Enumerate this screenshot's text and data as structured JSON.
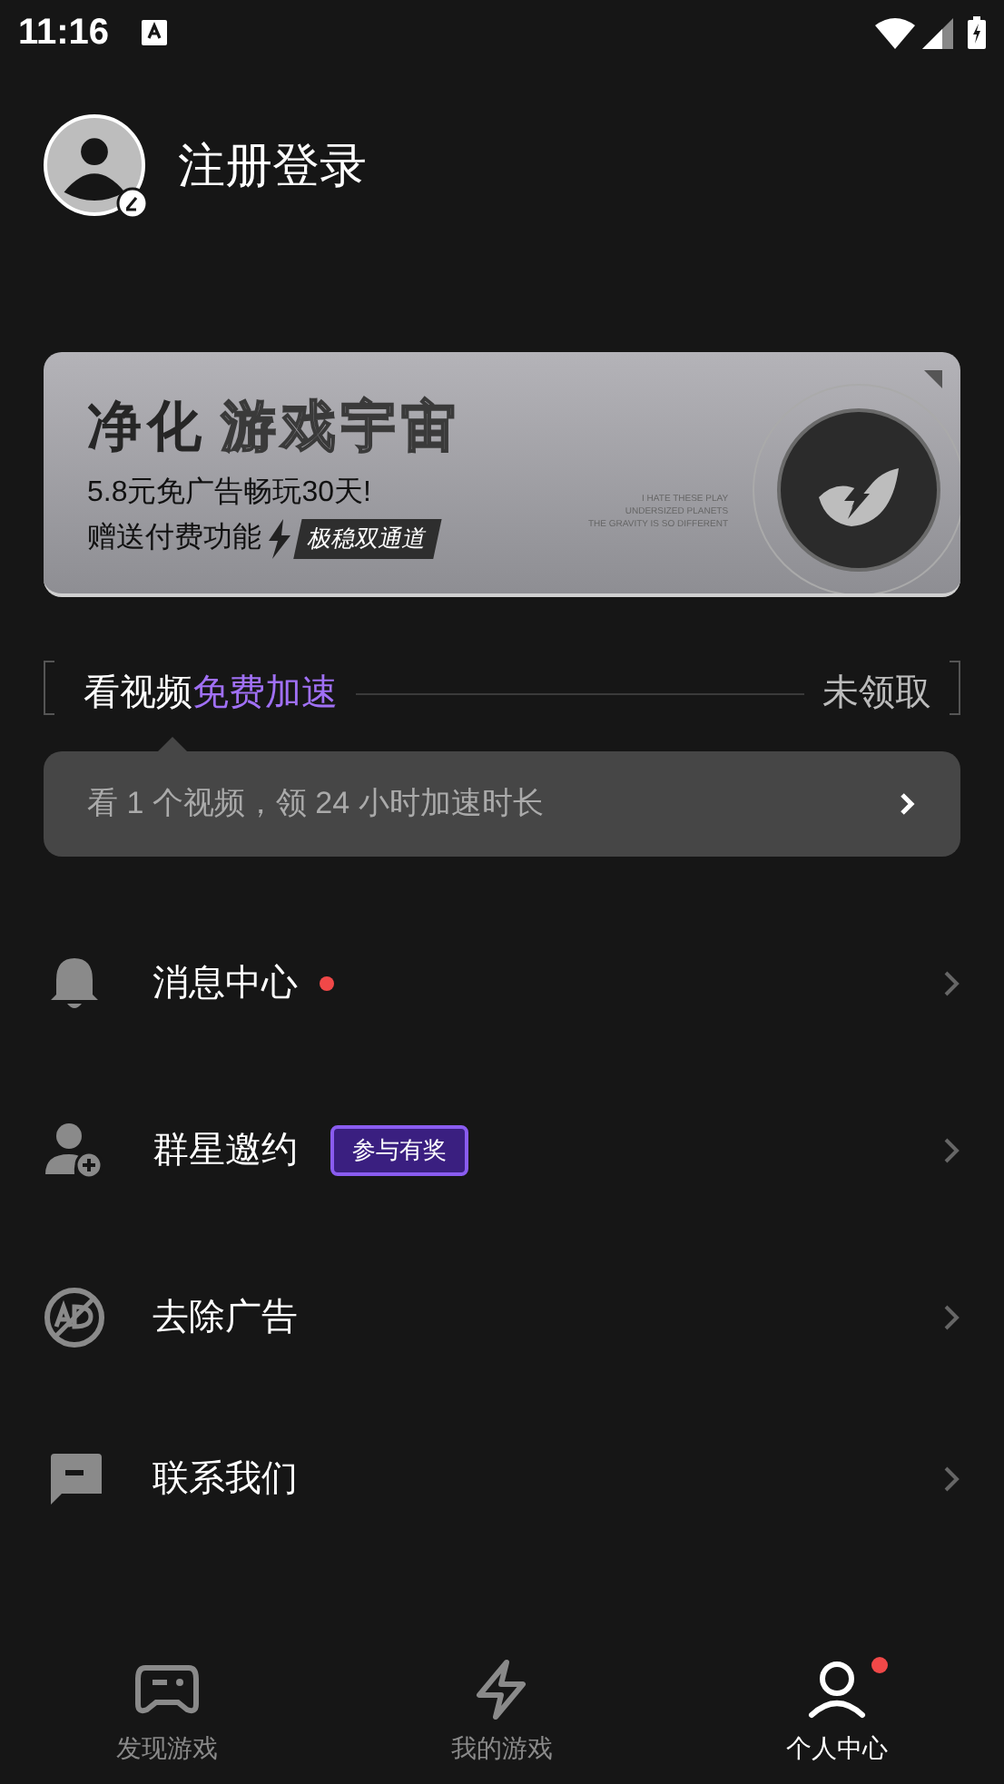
{
  "status_bar": {
    "time": "11:16"
  },
  "profile": {
    "login_label": "注册登录"
  },
  "banner": {
    "title_bold": "净化",
    "title_outline": "游戏宇宙",
    "line_1": "5.8元免广告畅玩30天!",
    "line_2": "赠送付费功能",
    "tag": "极稳双通道",
    "tagline": [
      "I HATE THESE PLAY",
      "UNDERSIZED PLANETS",
      "THE GRAVITY IS SO DIFFERENT"
    ]
  },
  "video_reward": {
    "title": "看视频",
    "highlight": "免费加速",
    "status": "未领取",
    "description": "看 1 个视频，领 24 小时加速时长"
  },
  "menu": [
    {
      "label": "消息中心",
      "kind": "dot"
    },
    {
      "label": "群星邀约",
      "kind": "badge",
      "badge": "参与有奖"
    },
    {
      "label": "去除广告",
      "kind": "plain"
    },
    {
      "label": "联系我们",
      "kind": "plain"
    }
  ],
  "bottom_nav": [
    {
      "label": "发现游戏",
      "selected": false,
      "dot": false
    },
    {
      "label": "我的游戏",
      "selected": false,
      "dot": false
    },
    {
      "label": "个人中心",
      "selected": true,
      "dot": true
    }
  ]
}
